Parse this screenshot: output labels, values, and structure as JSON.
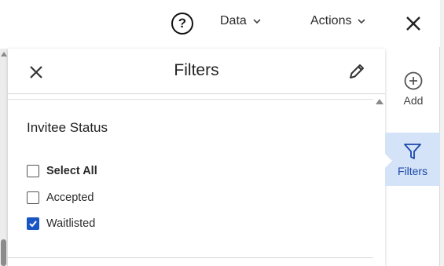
{
  "topbar": {
    "help_glyph": "?",
    "data_label": "Data",
    "actions_label": "Actions"
  },
  "panel": {
    "title": "Filters",
    "section_title": "Invitee Status",
    "options": [
      {
        "label": "Select All",
        "checked": false
      },
      {
        "label": "Accepted",
        "checked": false
      },
      {
        "label": "Waitlisted",
        "checked": true
      }
    ]
  },
  "rail": {
    "add_label": "Add",
    "filters_label": "Filters"
  },
  "colors": {
    "accent": "#1a55c5",
    "rail_selected_bg": "#d4e3f7",
    "rail_selected_text": "#1a47a8"
  }
}
